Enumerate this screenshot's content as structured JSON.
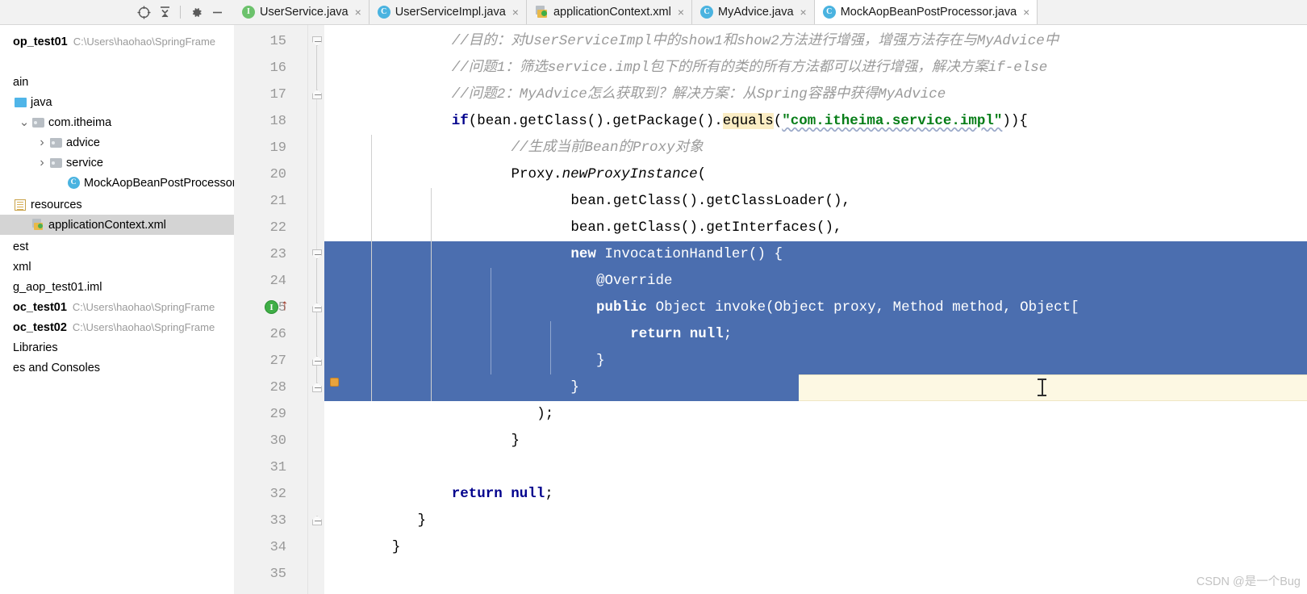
{
  "panel": {
    "toolbar": [
      {
        "name": "locate-in-tree-icon",
        "glyph": "crosshair"
      },
      {
        "name": "collapse-all-icon",
        "glyph": "collapse"
      },
      {
        "name": "settings-gear-icon",
        "glyph": "gear"
      },
      {
        "name": "hide-panel-icon",
        "glyph": "minus"
      }
    ],
    "tree": [
      {
        "label": "op_test01",
        "path": "C:\\Users\\haohao\\SpringFrame",
        "icon": "module-icon",
        "bold": true,
        "indent": 0,
        "arrow": "",
        "selected": false
      },
      {
        "label": "",
        "path": "",
        "icon": "none",
        "bold": false,
        "indent": 0,
        "arrow": "",
        "selected": false
      },
      {
        "label": "ain",
        "path": "",
        "icon": "none",
        "bold": false,
        "indent": 0,
        "arrow": "",
        "selected": false
      },
      {
        "label": "java",
        "path": "",
        "icon": "source-folder-icon",
        "bold": false,
        "indent": 0,
        "arrow": "",
        "selected": false
      },
      {
        "label": "com.itheima",
        "path": "",
        "icon": "folder-icon",
        "bold": false,
        "indent": 22,
        "arrow": "v",
        "selected": false
      },
      {
        "label": "advice",
        "path": "",
        "icon": "folder-icon",
        "bold": false,
        "indent": 44,
        "arrow": ">",
        "selected": false
      },
      {
        "label": "service",
        "path": "",
        "icon": "folder-icon",
        "bold": false,
        "indent": 44,
        "arrow": ">",
        "selected": false
      },
      {
        "label": "MockAopBeanPostProcessor",
        "path": "",
        "icon": "java-class-icon",
        "bold": false,
        "indent": 66,
        "arrow": "",
        "selected": false
      },
      {
        "label": "resources",
        "path": "",
        "icon": "resource-folder-icon",
        "bold": false,
        "indent": 0,
        "arrow": "",
        "selected": false
      },
      {
        "label": "applicationContext.xml",
        "path": "",
        "icon": "xml-file-icon",
        "bold": false,
        "indent": 22,
        "arrow": "",
        "selected": true
      },
      {
        "label": "est",
        "path": "",
        "icon": "none",
        "bold": false,
        "indent": 0,
        "arrow": "",
        "selected": false
      },
      {
        "label": "xml",
        "path": "",
        "icon": "none",
        "bold": false,
        "indent": 0,
        "arrow": "",
        "selected": false
      },
      {
        "label": "g_aop_test01.iml",
        "path": "",
        "icon": "none",
        "bold": false,
        "indent": 0,
        "arrow": "",
        "selected": false
      },
      {
        "label": "oc_test01",
        "path": "C:\\Users\\haohao\\SpringFrame",
        "icon": "none",
        "bold": true,
        "indent": 0,
        "arrow": "",
        "selected": false
      },
      {
        "label": "oc_test02",
        "path": "C:\\Users\\haohao\\SpringFrame",
        "icon": "none",
        "bold": true,
        "indent": 0,
        "arrow": "",
        "selected": false
      },
      {
        "label": "Libraries",
        "path": "",
        "icon": "none",
        "bold": false,
        "indent": 0,
        "arrow": "",
        "selected": false
      },
      {
        "label": "es and Consoles",
        "path": "",
        "icon": "none",
        "bold": false,
        "indent": 0,
        "arrow": "",
        "selected": false
      }
    ]
  },
  "tabs": [
    {
      "label": "UserService.java",
      "icon": "java-interface-icon",
      "active": false,
      "close": "×"
    },
    {
      "label": "UserServiceImpl.java",
      "icon": "java-class-icon",
      "active": false,
      "close": "×"
    },
    {
      "label": "applicationContext.xml",
      "icon": "xml-file-icon",
      "active": false,
      "close": "×"
    },
    {
      "label": "MyAdvice.java",
      "icon": "java-class-icon",
      "active": false,
      "close": "×"
    },
    {
      "label": "MockAopBeanPostProcessor.java",
      "icon": "java-class-icon",
      "active": true,
      "close": "×"
    }
  ],
  "editor": {
    "first_line": 15,
    "line_numbers": [
      15,
      16,
      17,
      18,
      19,
      20,
      21,
      22,
      23,
      24,
      25,
      26,
      27,
      28,
      29,
      30,
      31,
      32,
      33,
      34,
      35
    ],
    "lines": [
      {
        "n": 15,
        "indent": 14,
        "segments": [
          {
            "t": "//目的：对UserServiceImpl中的show1和show2方法进行增强，增强方法存在与MyAdvice中",
            "c": "cmt"
          }
        ]
      },
      {
        "n": 16,
        "indent": 14,
        "segments": [
          {
            "t": "//问题1：筛选service.impl包下的所有的类的所有方法都可以进行增强，解决方案if-else",
            "c": "cmt"
          }
        ]
      },
      {
        "n": 17,
        "indent": 14,
        "segments": [
          {
            "t": "//问题2：MyAdvice怎么获取到？解决方案：从Spring容器中获得MyAdvice",
            "c": "cmt"
          }
        ]
      },
      {
        "n": 18,
        "indent": 14,
        "segments": [
          {
            "t": "if",
            "c": "kw"
          },
          {
            "t": "(bean.getClass().getPackage().",
            "c": ""
          },
          {
            "t": "equals",
            "c": "hl-equals"
          },
          {
            "t": "(",
            "c": ""
          },
          {
            "t": "\"com.itheima.service.impl\"",
            "c": "str squig"
          },
          {
            "t": ")){",
            "c": ""
          }
        ]
      },
      {
        "n": 19,
        "indent": 21,
        "segments": [
          {
            "t": "//生成当前Bean的Proxy对象",
            "c": "cmt"
          }
        ]
      },
      {
        "n": 20,
        "indent": 21,
        "segments": [
          {
            "t": "Proxy.",
            "c": ""
          },
          {
            "t": "newProxyInstance",
            "c": "sta"
          },
          {
            "t": "(",
            "c": ""
          }
        ]
      },
      {
        "n": 21,
        "indent": 28,
        "segments": [
          {
            "t": "bean.getClass().getClassLoader(),",
            "c": ""
          }
        ]
      },
      {
        "n": 22,
        "indent": 28,
        "segments": [
          {
            "t": "bean.getClass().getInterfaces(),",
            "c": ""
          }
        ]
      },
      {
        "n": 23,
        "indent": 28,
        "segments": [
          {
            "t": "new",
            "c": "kw"
          },
          {
            "t": " InvocationHandler() {",
            "c": ""
          }
        ],
        "sel": true
      },
      {
        "n": 24,
        "indent": 31,
        "segments": [
          {
            "t": "@Override",
            "c": ""
          }
        ],
        "sel": true
      },
      {
        "n": 25,
        "indent": 31,
        "segments": [
          {
            "t": "public",
            "c": "kw"
          },
          {
            "t": " Object invoke(Object proxy, Method method, Object[",
            "c": ""
          }
        ],
        "sel": true
      },
      {
        "n": 26,
        "indent": 35,
        "segments": [
          {
            "t": "return",
            "c": "kw"
          },
          {
            "t": " ",
            "c": ""
          },
          {
            "t": "null",
            "c": "kw"
          },
          {
            "t": ";",
            "c": ""
          }
        ],
        "sel": true
      },
      {
        "n": 27,
        "indent": 31,
        "segments": [
          {
            "t": "}",
            "c": ""
          }
        ],
        "sel": true
      },
      {
        "n": 28,
        "indent": 28,
        "segments": [
          {
            "t": "}",
            "c": ""
          }
        ],
        "sel": true,
        "current": true
      },
      {
        "n": 29,
        "indent": 24,
        "segments": [
          {
            "t": ");",
            "c": ""
          }
        ]
      },
      {
        "n": 30,
        "indent": 21,
        "segments": [
          {
            "t": "}",
            "c": ""
          }
        ]
      },
      {
        "n": 31,
        "indent": 0,
        "segments": [
          {
            "t": "",
            "c": ""
          }
        ]
      },
      {
        "n": 32,
        "indent": 14,
        "segments": [
          {
            "t": "return",
            "c": "kw"
          },
          {
            "t": " ",
            "c": ""
          },
          {
            "t": "null",
            "c": "kw"
          },
          {
            "t": ";",
            "c": ""
          }
        ]
      },
      {
        "n": 33,
        "indent": 10,
        "segments": [
          {
            "t": "}",
            "c": ""
          }
        ]
      },
      {
        "n": 34,
        "indent": 7,
        "segments": [
          {
            "t": "}",
            "c": ""
          }
        ]
      },
      {
        "n": 35,
        "indent": 0,
        "segments": [
          {
            "t": "",
            "c": ""
          }
        ]
      }
    ],
    "gutter_markers": {
      "implements_line": 25,
      "implements_glyph": "I",
      "override_arrow_line": 25,
      "override_arrow_glyph": "↑",
      "bookmark_line": 28
    },
    "fold_markers": [
      {
        "line": 15,
        "dir": "down"
      },
      {
        "line": 17,
        "dir": "up"
      },
      {
        "line": 23,
        "dir": "down"
      },
      {
        "line": 25,
        "dir": "up"
      },
      {
        "line": 27,
        "dir": "up"
      },
      {
        "line": 28,
        "dir": "up"
      },
      {
        "line": 33,
        "dir": "up"
      }
    ]
  },
  "watermark": "CSDN @是一个Bug",
  "colors": {
    "selection": "#4b6eaf",
    "current_line": "#fdf8e3",
    "string": "#067d17",
    "keyword": "#00008c",
    "comment": "#9a9a9a",
    "highlight": "#fbedc4"
  }
}
